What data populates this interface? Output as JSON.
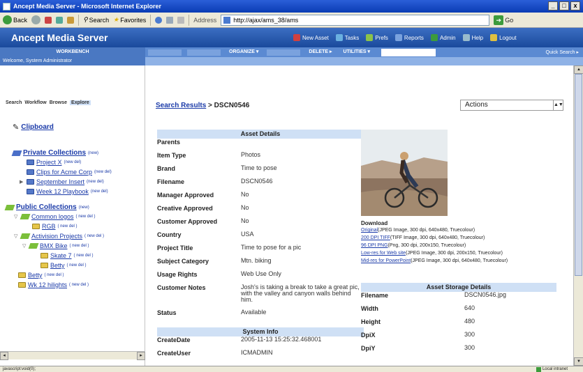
{
  "window": {
    "title": "Ancept Media Server - Microsoft Internet Explorer"
  },
  "ie_toolbar": {
    "back": "Back",
    "search": "Search",
    "favorites": "Favorites",
    "address_label": "Address",
    "address": "http://ajax/ams_38/ams",
    "go": "Go"
  },
  "app": {
    "title": "Ancept Media Server",
    "nav": [
      "New Asset",
      "Tasks",
      "Prefs",
      "Reports",
      "Admin",
      "Help",
      "Logout"
    ],
    "menu": {
      "workbench": "WORKBENCH",
      "organize": "ORGANIZE",
      "delete": "DELETE",
      "utilities": "UTILITIES",
      "quick_search": "Quick Search"
    },
    "welcome": "Welcome, System Administrator"
  },
  "left": {
    "tabs": [
      "Search",
      "Workflow",
      "Browse",
      "Explore"
    ],
    "clipboard": "Clipboard",
    "private_title": "Private Collections",
    "private_new": "(new)",
    "private_items": [
      {
        "label": "Project X",
        "links": "(new del)"
      },
      {
        "label": "Clips for Acme Corp",
        "links": "(new del)"
      },
      {
        "label": "September Insert",
        "links": "(new del)"
      },
      {
        "label": "Week 12 Playbook",
        "links": "(new del)"
      }
    ],
    "public_title": "Public Collections",
    "public_new": "(new)",
    "public_items": [
      {
        "label": "Common logos",
        "links": "( new del )"
      },
      {
        "label": "RGB",
        "links": "( new del )"
      },
      {
        "label": "Activision Projects",
        "links": "( new del )"
      },
      {
        "label": "BMX Bike",
        "links": "( new del )"
      },
      {
        "label": "Skate 7",
        "links": "( new del )"
      },
      {
        "label": "Betty",
        "links": "( new del )"
      },
      {
        "label": "Betty",
        "links": "( new del )"
      },
      {
        "label": "Wk 12 hilights",
        "links": "( new del )"
      }
    ]
  },
  "main": {
    "crumb_link": "Search Results",
    "crumb_sep": ">",
    "crumb_current": "DSCN0546",
    "actions": "Actions",
    "asset_header": "Asset Details",
    "details": [
      {
        "k": "Parents",
        "v": ""
      },
      {
        "k": "Item Type",
        "v": "Photos"
      },
      {
        "k": "Brand",
        "v": "Time to pose"
      },
      {
        "k": "Filename",
        "v": "DSCN0546"
      },
      {
        "k": "Manager Approved",
        "v": "No"
      },
      {
        "k": "Creative Approved",
        "v": "No"
      },
      {
        "k": "Customer Approved",
        "v": "No"
      },
      {
        "k": "Country",
        "v": "USA"
      },
      {
        "k": "Project Title",
        "v": "Time to pose for a pic"
      },
      {
        "k": "Subject Category",
        "v": "Mtn. biking"
      },
      {
        "k": "Usage Rights",
        "v": "Web Use Only"
      },
      {
        "k": "Customer Notes",
        "v": "Josh's is taking a break to take a great pic, with the valley and canyon walls behind him."
      },
      {
        "k": "Status",
        "v": "Available"
      }
    ],
    "system_header": "System Info",
    "system": [
      {
        "k": "CreateDate",
        "v": "2005-11-13 15:25:32.468001"
      },
      {
        "k": "CreateUser",
        "v": "ICMADMIN"
      }
    ],
    "download_title": "Download",
    "downloads": [
      {
        "link": "Original",
        "desc": "(JPEG Image, 300 dpi, 640x480, Truecolour)"
      },
      {
        "link": "200 DPI TIFF",
        "desc": "(TIFF Image, 300 dpi, 640x480, Truecolour)"
      },
      {
        "link": "96 DPI PNG",
        "desc": "(Png, 300 dpi, 200x150, Truecolour)"
      },
      {
        "link": "Low-res for Web site",
        "desc": "(JPEG Image, 300 dpi, 200x150, Truecolour)"
      },
      {
        "link": "Mid-res for PowerPoint",
        "desc": "(JPEG Image, 300 dpi, 640x480, Truecolour)"
      }
    ],
    "storage_header": "Asset Storage Details",
    "storage": [
      {
        "k": "Filename",
        "v": "DSCN0546.jpg"
      },
      {
        "k": "Width",
        "v": "640"
      },
      {
        "k": "Height",
        "v": "480"
      },
      {
        "k": "DpiX",
        "v": "300"
      },
      {
        "k": "DpiY",
        "v": "300"
      }
    ]
  },
  "status": {
    "left": "javascript:void(0);",
    "zone": "Local intranet"
  }
}
